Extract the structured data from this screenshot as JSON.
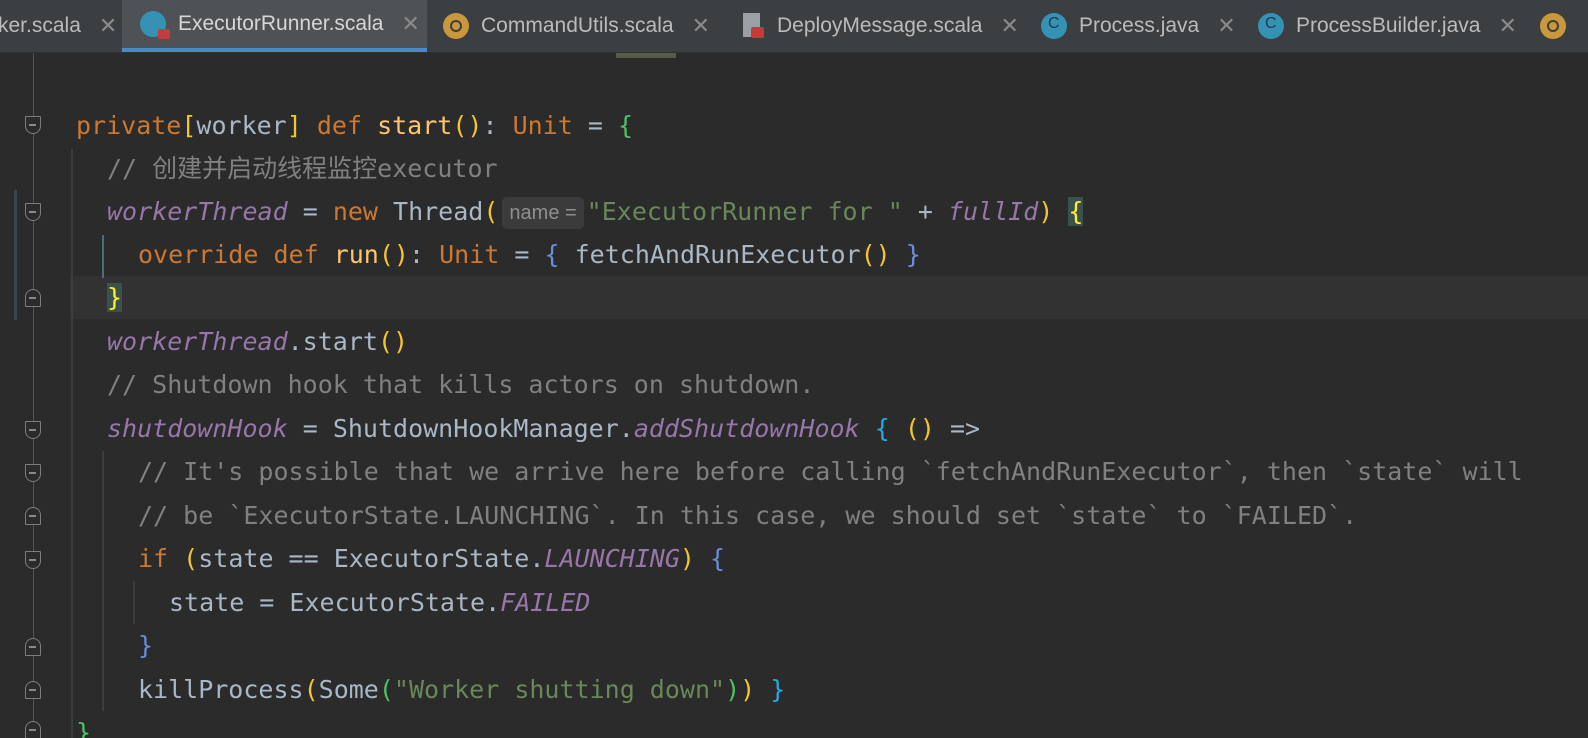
{
  "tabs": [
    {
      "name": "ker.scala",
      "icon": "none",
      "active": false
    },
    {
      "name": "ExecutorRunner.scala",
      "icon": "scala-class-icon",
      "active": true
    },
    {
      "name": "CommandUtils.scala",
      "icon": "scala-object-icon",
      "active": false
    },
    {
      "name": "DeployMessage.scala",
      "icon": "scala-file-icon",
      "active": false
    },
    {
      "name": "Process.java",
      "icon": "java-class-icon",
      "active": false
    },
    {
      "name": "ProcessBuilder.java",
      "icon": "java-class-icon",
      "active": false
    }
  ],
  "close_glyph": "✕",
  "inlay_hint": "name =",
  "code": {
    "l1": {
      "kw_private": "private",
      "mod_open": "[",
      "mod_name": "worker",
      "mod_close": "]",
      "kw_def": "def",
      "fn_name": "start",
      "parens": "()",
      "colon": ":",
      "ret_type": "Unit",
      "eq": "=",
      "brace": "{"
    },
    "l2": {
      "comment": "// 创建并启动线程监控executor"
    },
    "l3": {
      "var": "workerThread",
      "eq": "=",
      "kw_new": "new",
      "cls": "Thread",
      "paren_open": "(",
      "str": "\"ExecutorRunner for \"",
      "plus": "+",
      "var2": "fullId",
      "paren_close": ")",
      "brace": "{"
    },
    "l4": {
      "kw_override": "override",
      "kw_def": "def",
      "fn_name": "run",
      "parens": "()",
      "colon": ":",
      "ret_type": "Unit",
      "eq": "=",
      "brace_open": "{",
      "call": "fetchAndRunExecutor",
      "call_parens": "()",
      "brace_close": "}"
    },
    "l5": {
      "brace": "}"
    },
    "l6": {
      "var": "workerThread",
      "rest": ".start",
      "parens": "()"
    },
    "l7": {
      "comment": "// Shutdown hook that kills actors on shutdown."
    },
    "l8": {
      "var": "shutdownHook",
      "eq": "=",
      "obj": "ShutdownHookManager.",
      "method": "addShutdownHook",
      "brace": "{",
      "parens": "()",
      "arrow": "=>"
    },
    "l9": {
      "comment": "// It's possible that we arrive here before calling `fetchAndRunExecutor`, then `state` will"
    },
    "l10": {
      "comment": "// be `ExecutorState.LAUNCHING`. In this case, we should set `state` to `FAILED`."
    },
    "l11": {
      "kw_if": "if",
      "paren_open": "(",
      "cond": "state == ExecutorState.",
      "const": "LAUNCHING",
      "paren_close": ")",
      "brace": "{"
    },
    "l12": {
      "lhs": "state = ExecutorState.",
      "const": "FAILED"
    },
    "l13": {
      "brace": "}"
    },
    "l14": {
      "call": "killProcess",
      "p1": "(",
      "some": "Some",
      "p2": "(",
      "str": "\"Worker shutting down\"",
      "p3": ")",
      "p4": ")",
      "brace": "}"
    },
    "l15": {
      "brace": "}"
    }
  }
}
